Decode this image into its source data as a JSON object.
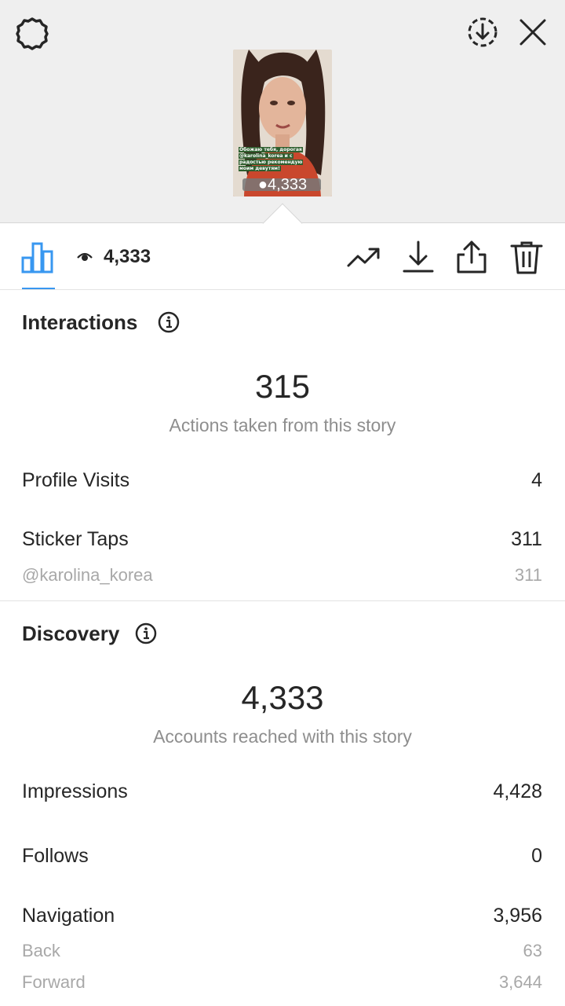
{
  "header": {
    "icons": [
      "settings-gear-icon",
      "save-download-circle-icon",
      "close-icon"
    ]
  },
  "story_preview": {
    "caption_lines": [
      "Обожаю тебя, дорогая",
      "@karolina_korea и с",
      "радостью рекомендую",
      "моим девутям!"
    ],
    "mention": "@karolina_korea",
    "views": "4,333"
  },
  "toolbar": {
    "views_count": "4,333",
    "icons": [
      "bar-chart-icon",
      "eye-icon",
      "promote-trend-icon",
      "download-icon",
      "share-icon",
      "trash-icon"
    ],
    "active_color": "#3897f0"
  },
  "interactions": {
    "title": "Interactions",
    "total": "315",
    "total_label": "Actions taken from this story",
    "rows": [
      {
        "label": "Profile Visits",
        "value": "4"
      },
      {
        "label": "Sticker Taps",
        "value": "311"
      }
    ],
    "sub_rows": [
      {
        "label": "@karolina_korea",
        "value": "311"
      }
    ]
  },
  "discovery": {
    "title": "Discovery",
    "total": "4,333",
    "total_label": "Accounts reached with this story",
    "rows": [
      {
        "label": "Impressions",
        "value": "4,428"
      },
      {
        "label": "Follows",
        "value": "0"
      },
      {
        "label": "Navigation",
        "value": "3,956"
      }
    ],
    "sub_rows": [
      {
        "label": "Back",
        "value": "63"
      },
      {
        "label": "Forward",
        "value": "3,644"
      }
    ]
  }
}
